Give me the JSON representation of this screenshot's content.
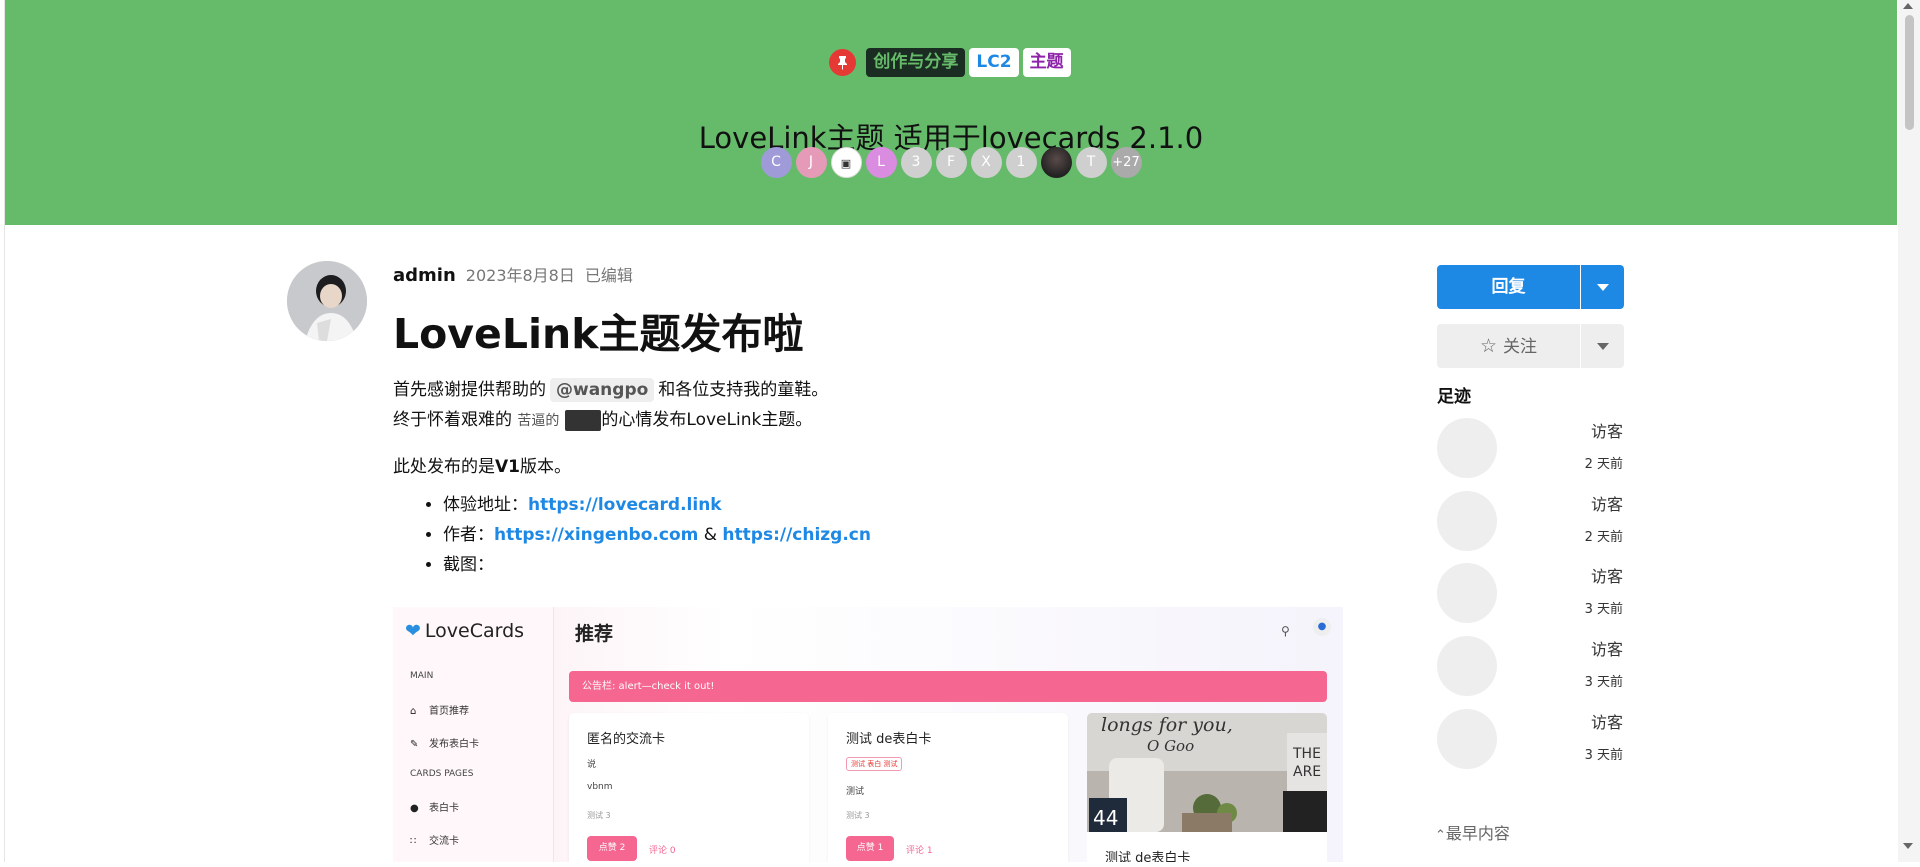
{
  "hero": {
    "tags": [
      "创作与分享",
      "LC2",
      "主题"
    ],
    "title": "LoveLink主题 适用于lovecards 2.1.0",
    "participants": [
      {
        "initial": "C",
        "color": "#9e9bd8"
      },
      {
        "initial": "J",
        "color": "#e59bb8"
      },
      {
        "initial": "",
        "color": "#ffffff"
      },
      {
        "initial": "L",
        "color": "#d98ce0"
      },
      {
        "initial": "3",
        "color": "#cfcfcf"
      },
      {
        "initial": "F",
        "color": "#cfcfcf"
      },
      {
        "initial": "X",
        "color": "#cfcfcf"
      },
      {
        "initial": "1",
        "color": "#cfcfcf"
      },
      {
        "initial": "",
        "color": "#2b2b2b"
      },
      {
        "initial": "T",
        "color": "#cfcfcf"
      }
    ],
    "more_count": "+27"
  },
  "post": {
    "author": "admin",
    "date": "2023年8月8日",
    "edited": "已编辑",
    "title": "LoveLink主题发布啦",
    "line1_pre": "首先感谢提供帮助的",
    "mention": "@wangpo",
    "line1_post": "和各位支持我的童鞋。",
    "line2_pre": "终于怀着艰难的",
    "line2_small": "苦逼的",
    "line2_post": "的心情发布LoveLink主题。",
    "version_pre": "此处发布的是",
    "version_bold": "V1",
    "version_post": "版本。",
    "list": {
      "demo_label": "体验地址：",
      "demo_link": "https://lovecard.link",
      "author_label": "作者：",
      "author_link1": "https://xingenbo.com",
      "amp": "&",
      "author_link2": "https://chizg.cn",
      "screenshot_label": "截图："
    }
  },
  "screenshot": {
    "logo": "LoveCards",
    "section_main": "MAIN",
    "item_home": "首页推荐",
    "item_publish": "发布表白卡",
    "section_cards": "CARDS PAGES",
    "item_confession": "表白卡",
    "item_exchange": "交流卡",
    "page_title": "推荐",
    "notice": "公告栏:  alert—check it out!",
    "card1": {
      "title": "匿名的交流卡",
      "line1": "说",
      "line2": "vbnm",
      "meta": "测试 3",
      "likes": "点赞 2",
      "comments": "评论 0"
    },
    "card2": {
      "title": "测试 de表白卡",
      "badge": "测试 表白 测试",
      "line1": "测试",
      "meta": "测试 3",
      "likes": "点赞 1",
      "comments": "评论 1"
    },
    "card3": {
      "title": "测试 de表白卡"
    }
  },
  "sidebar": {
    "reply": "回复",
    "follow": "关注",
    "footprint_title": "足迹",
    "footprints": [
      {
        "name": "访客",
        "time": "2 天前"
      },
      {
        "name": "访客",
        "time": "2 天前"
      },
      {
        "name": "访客",
        "time": "3 天前"
      },
      {
        "name": "访客",
        "time": "3 天前"
      },
      {
        "name": "访客",
        "time": "3 天前"
      }
    ],
    "earliest": "最早内容"
  }
}
